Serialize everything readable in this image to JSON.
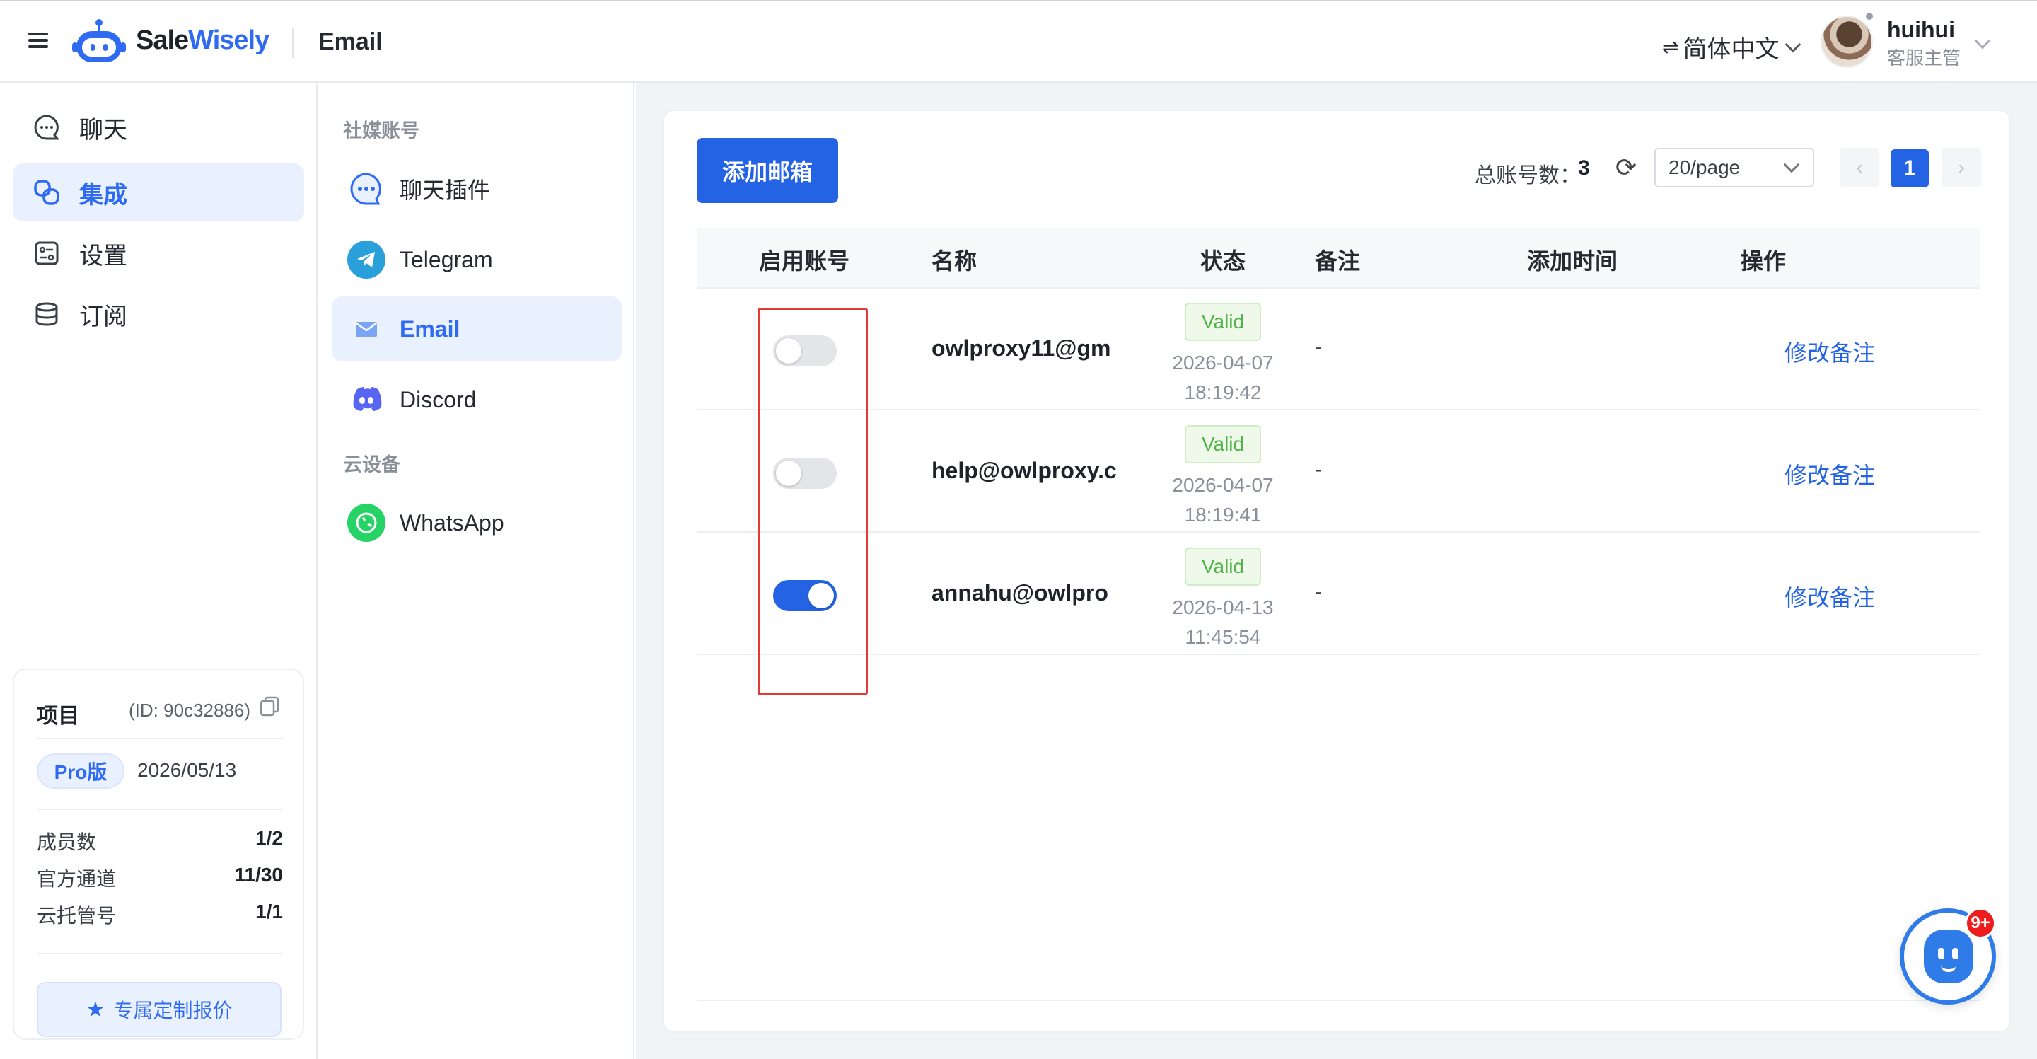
{
  "header": {
    "brand_first": "Sale",
    "brand_second": "Wisely",
    "page_title": "Email",
    "language": "简体中文",
    "user_name": "huihui",
    "user_role": "客服主管"
  },
  "left_nav": {
    "items": [
      {
        "label": "聊天",
        "icon": "chat-icon"
      },
      {
        "label": "集成",
        "icon": "integration-icon",
        "active": true
      },
      {
        "label": "设置",
        "icon": "settings-icon"
      },
      {
        "label": "订阅",
        "icon": "subscription-icon"
      }
    ]
  },
  "project": {
    "title": "项目",
    "id_text": "(ID: 90c32886)",
    "plan": "Pro版",
    "expiry": "2026/05/13",
    "stats": [
      {
        "label": "成员数",
        "value": "1/2"
      },
      {
        "label": "官方通道",
        "value": "11/30"
      },
      {
        "label": "云托管号",
        "value": "1/1"
      }
    ],
    "quote_label": "专属定制报价"
  },
  "sub_nav": {
    "section_social": "社媒账号",
    "section_cloud": "云设备",
    "items": [
      {
        "label": "聊天插件",
        "icon": "chat-plugin-icon"
      },
      {
        "label": "Telegram",
        "icon": "telegram-icon"
      },
      {
        "label": "Email",
        "icon": "email-icon",
        "active": true
      },
      {
        "label": "Discord",
        "icon": "discord-icon"
      },
      {
        "label": "WhatsApp",
        "icon": "whatsapp-icon"
      }
    ]
  },
  "toolbar": {
    "add_button": "添加邮箱",
    "total_label": "总账号数：",
    "total_value": "3",
    "page_size": "20/page",
    "current_page": "1",
    "prev": "‹",
    "next": "›"
  },
  "table": {
    "headers": [
      "启用账号",
      "名称",
      "状态",
      "备注",
      "添加时间",
      "操作"
    ],
    "rows": [
      {
        "enabled": false,
        "name": "owlproxy11@gm",
        "status": "Valid",
        "date": "2026-04-07",
        "time": "18:19:42",
        "note": "-",
        "action": "修改备注"
      },
      {
        "enabled": false,
        "name": "help@owlproxy.c",
        "status": "Valid",
        "date": "2026-04-07",
        "time": "18:19:41",
        "note": "-",
        "action": "修改备注"
      },
      {
        "enabled": true,
        "name": "annahu@owlpro",
        "status": "Valid",
        "date": "2026-04-13",
        "time": "11:45:54",
        "note": "-",
        "action": "修改备注"
      }
    ]
  },
  "support": {
    "badge": "9+"
  },
  "colors": {
    "accent": "#2563e5",
    "valid_text": "#52b34a",
    "highlight_border": "#e53935"
  }
}
